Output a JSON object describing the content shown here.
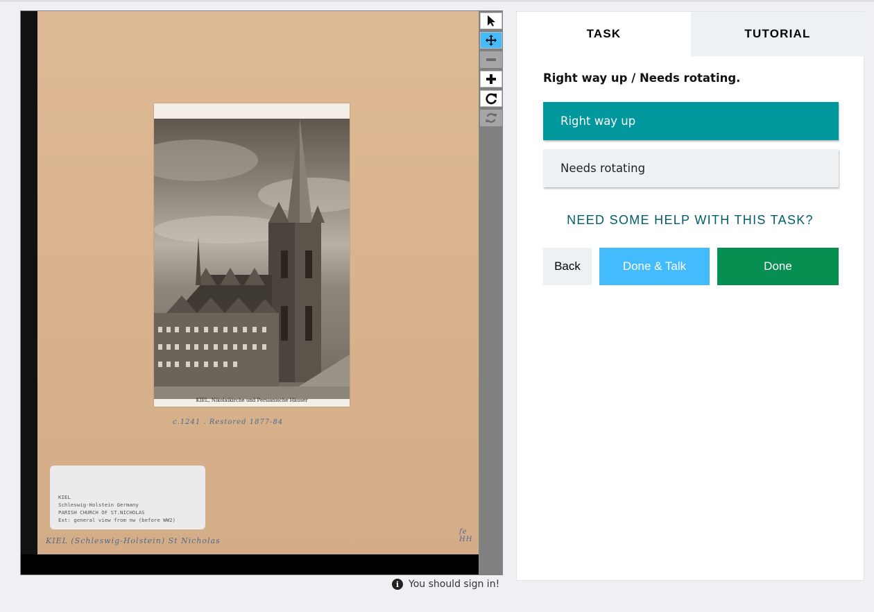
{
  "viewer": {
    "photo_caption": "KIEL, Nikolaikirche und Persianische Häuser",
    "pencil_note": "c.1241 . Restored 1877-84",
    "label_lines": [
      "KIEL",
      "Schleswig-Holstein Germany",
      "PARISH CHURCH OF ST.NICHOLAS",
      "Ext: general view from nw (before WW2)"
    ],
    "bottom_note": "KIEL (Schleswig-Holstein) St Nicholas",
    "corner_note": "fe HH"
  },
  "toolbar": {
    "tools": [
      "pointer-icon",
      "move-icon",
      "zoom-out-icon",
      "zoom-in-icon",
      "rotate-icon",
      "reset-icon"
    ]
  },
  "status": {
    "signin": "You should sign in!"
  },
  "panel": {
    "tabs": [
      {
        "label": "TASK"
      },
      {
        "label": "TUTORIAL"
      }
    ],
    "question": "Right way up / Needs rotating.",
    "answers": [
      {
        "label": "Right way up"
      },
      {
        "label": "Needs rotating"
      }
    ],
    "help": "NEED SOME HELP WITH THIS TASK?",
    "buttons": {
      "back": "Back",
      "talk": "Done & Talk",
      "done": "Done"
    }
  },
  "colors": {
    "selected": "#00979d",
    "done": "#078f52",
    "talk": "#43bbfd",
    "help": "#005d69"
  }
}
